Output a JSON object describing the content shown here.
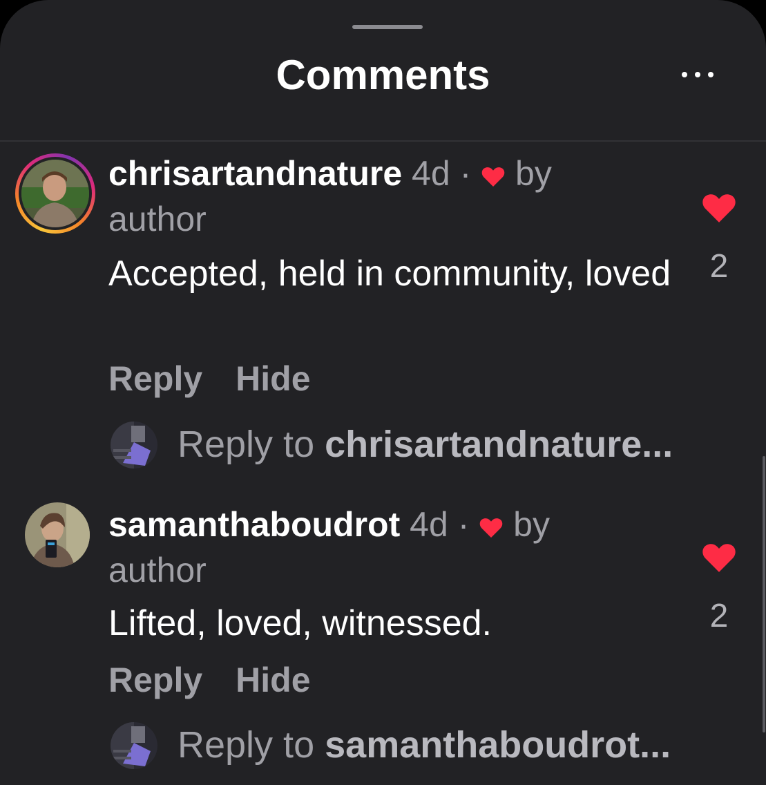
{
  "header": {
    "title": "Comments",
    "more_icon": "ellipsis-horizontal-icon"
  },
  "colors": {
    "background": "#222225",
    "heart": "#fe2c45",
    "secondary_text": "#a0a0a6"
  },
  "comments": [
    {
      "username": "chrisartandnature",
      "time": "4d",
      "separator": "·",
      "liked_by_prefix": "by",
      "liked_by": "author",
      "text": "Accepted, held in community, loved",
      "like_count": "2",
      "reply_label": "Reply",
      "hide_label": "Hide",
      "reply_placeholder_prefix": "Reply to",
      "reply_placeholder_name": "chrisartandnature..."
    },
    {
      "username": "samanthaboudrot",
      "time": "4d",
      "separator": "·",
      "liked_by_prefix": "by",
      "liked_by": "author",
      "text": "Lifted, loved, witnessed.",
      "like_count": "2",
      "reply_label": "Reply",
      "hide_label": "Hide",
      "reply_placeholder_prefix": "Reply to",
      "reply_placeholder_name": "samanthaboudrot..."
    }
  ]
}
